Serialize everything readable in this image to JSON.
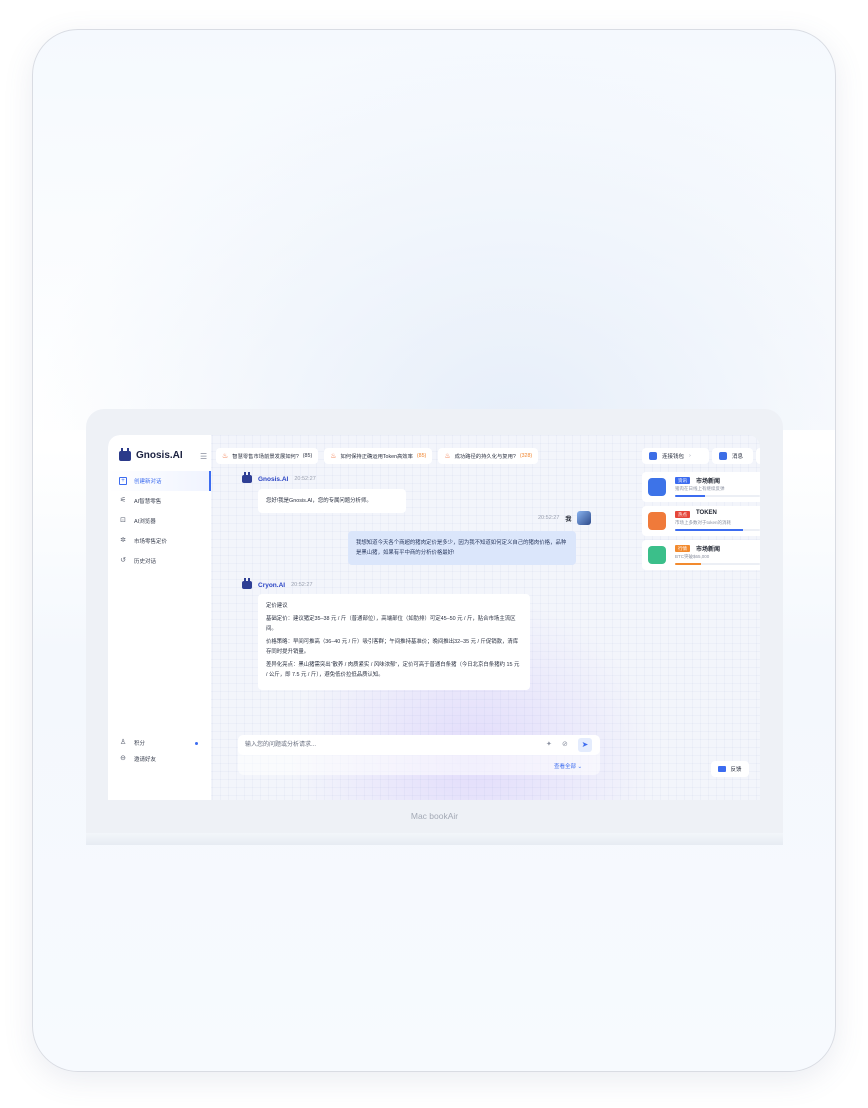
{
  "brand": {
    "name": "Gnosis.AI"
  },
  "sidebar": {
    "items": [
      {
        "label": "创建新对话",
        "icon": "plus-square-icon",
        "active": true
      },
      {
        "label": "AI智慧零售",
        "icon": "spark-icon"
      },
      {
        "label": "AI浏览器",
        "icon": "browser-icon"
      },
      {
        "label": "市场零售定价",
        "icon": "gear-icon"
      },
      {
        "label": "历史对话",
        "icon": "history-icon"
      }
    ],
    "bottom": [
      {
        "label": "积分",
        "icon": "user-icon"
      },
      {
        "label": "邀请好友",
        "icon": "gift-icon"
      }
    ]
  },
  "topics": [
    {
      "text": "智慧零售市场前景发展如何?",
      "count": "(85)"
    },
    {
      "text": "如何保持正确运用Token高效率",
      "count": "(85)"
    },
    {
      "text": "成功路径的持久化与复用?",
      "count": "(328)"
    }
  ],
  "header": {
    "wallet_label": "连接钱包",
    "message_label": "消息",
    "more_label": "···"
  },
  "chat": {
    "bot1": {
      "name": "Gnosis.AI",
      "time": "20:52:27",
      "text": "您好!我是Gnosis.AI，您的专属问题分析师。"
    },
    "user": {
      "time": "20:52:27",
      "label": "我",
      "text": "我想知道今天各个商超的猪肉定价是多少，因为我不知道如何定义自己的猪肉价格，品种是黑山猪，如果有平中商的分析价格最好!"
    },
    "bot2": {
      "name": "Cryon.AI",
      "time": "20:52:27",
      "title": "定价建议",
      "p1": "基础定价：建议猪定35–38 元 / 斤（普通部位），高端部位（如肋排）可定45–50 元 / 斤，贴合市场主流区间。",
      "p2": "价格策略：早间可推高（36–40 元 / 斤）吸引客群；午间推持基准价；晚间推出32–35 元 / 斤促销款，清库存同时提升销量。",
      "p3": "差异化亮点：黑山猪需突出“散养 / 肉质紧实 / 风味浓郁”，定价可高于普通白条猪（今日北京白条猪约 15 元 / 公斤，即 7.5 元 / 斤），避免低价拉低品质认知。"
    }
  },
  "composer": {
    "placeholder": "输入您的问题或分析请求...",
    "view_all": "查看全部 ⌄"
  },
  "news": [
    {
      "tag": "资讯",
      "title": "市场新闻",
      "sub": "猪肉在日线上有继续反弹",
      "progress": 0.35,
      "tag_color": "#3c6cf0",
      "thumb_color": "#3d73e8",
      "bar_color": "#3c6cf0"
    },
    {
      "tag": "热点",
      "title": "TOKEN",
      "sub": "市场上多数对于token的消耗",
      "progress": 0.8,
      "tag_color": "#e5463a",
      "thumb_color": "#f07a3a",
      "bar_color": "#3c6cf0"
    },
    {
      "tag": "行情",
      "title": "市场新闻",
      "sub": "BTC突破$65,000",
      "progress": 0.3,
      "tag_color": "#f28a2e",
      "thumb_color": "#3bbf8a",
      "bar_color": "#f28a2e"
    }
  ],
  "feedback": {
    "label": "反馈"
  },
  "device": {
    "label": "Mac bookAir"
  }
}
